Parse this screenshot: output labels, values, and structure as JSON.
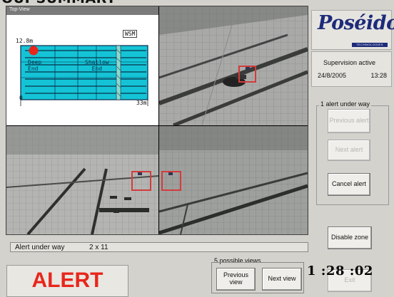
{
  "page_title": "OUI-SUMMARY",
  "camera_overlay_label": "Top-View",
  "pool_map": {
    "depth_label": "12.8m",
    "zone_label": "WSM",
    "deep_end": "Deep\nEnd",
    "shallow_end": "Shallow\nEnd",
    "origin": "0",
    "length_label": "33m"
  },
  "brand": {
    "logo": "Poséidon",
    "tagline": "TECHNOLOGIES"
  },
  "supervision": {
    "status": "Supervision active",
    "date": "24/8/2005",
    "time": "13:28"
  },
  "alerts": {
    "group_title": "1 alert under way",
    "previous_alert": "Previous alert",
    "next_alert": "Next alert",
    "cancel_alert": "Cancel alert"
  },
  "disable_zone": "Disable zone",
  "status_bar": {
    "message": "Alert under way",
    "value": "2 x 11"
  },
  "alert_banner": "ALERT",
  "views": {
    "label": "5 possible views",
    "previous_view": "Previous view",
    "next_view": "Next view"
  },
  "exit_label": "Exit",
  "timer": "1 :28 :02"
}
